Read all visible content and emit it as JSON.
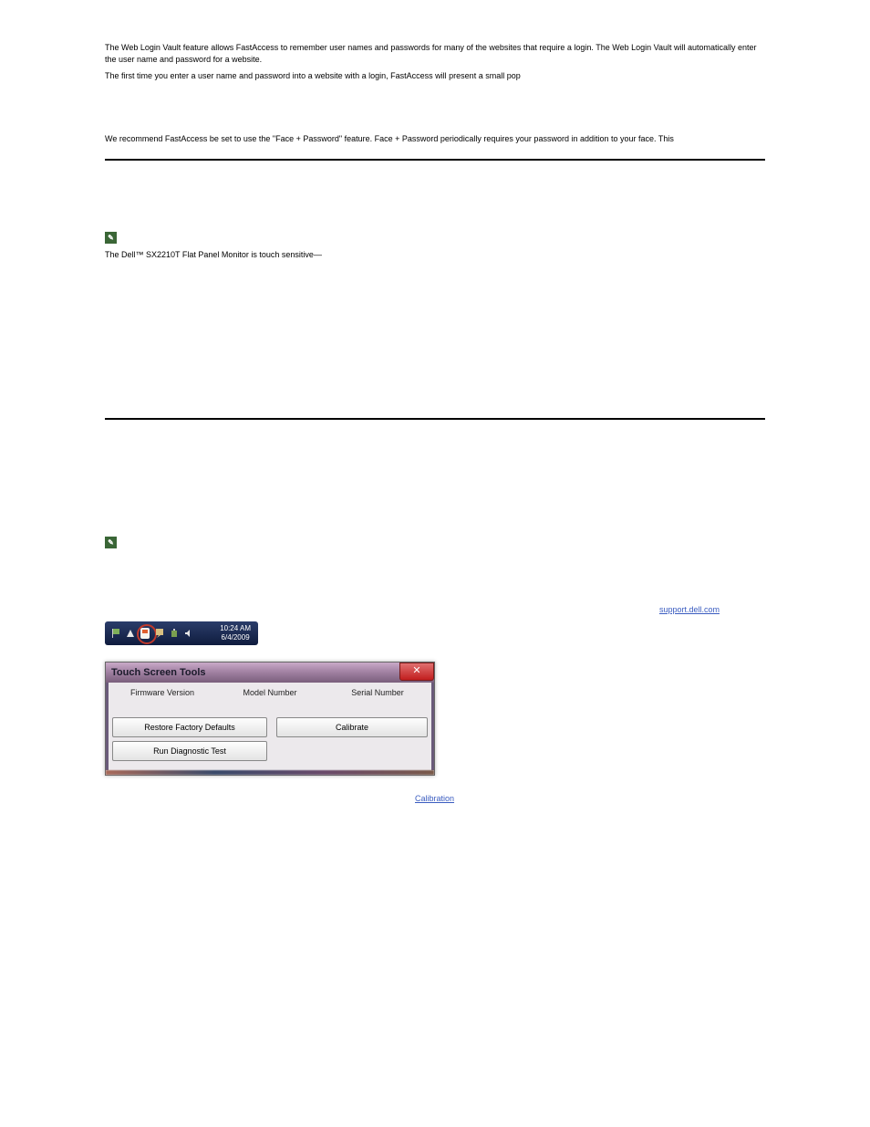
{
  "vault": {
    "p1": "The Web Login Vault feature allows FastAccess to remember user names and passwords for many of the websites that require a login. The Web Login Vault will automatically enter the user name and password for a website.",
    "p2": "The first time you enter a user name and password into a website with a login, FastAccess will present a small pop"
  },
  "security": {
    "p1": "We recommend FastAccess be set to use the \"Face + Password\" feature.  Face + Password periodically requires your password in addition to your face.  This"
  },
  "touch": {
    "intro": "The Dell™ SX2210T Flat Panel Monitor is touch sensitive—"
  },
  "tools": {
    "link_text": "support.dell.com",
    "taskbar_time": "10:24 AM",
    "taskbar_date": "6/4/2009",
    "dialog": {
      "title": "Touch Screen Tools",
      "labels": [
        "Firmware Version",
        "Model Number",
        "Serial Number"
      ],
      "btn_restore": "Restore Factory Defaults",
      "btn_calibrate": "Calibrate",
      "btn_diag": "Run Diagnostic Test"
    },
    "calibration_link": "Calibration"
  }
}
